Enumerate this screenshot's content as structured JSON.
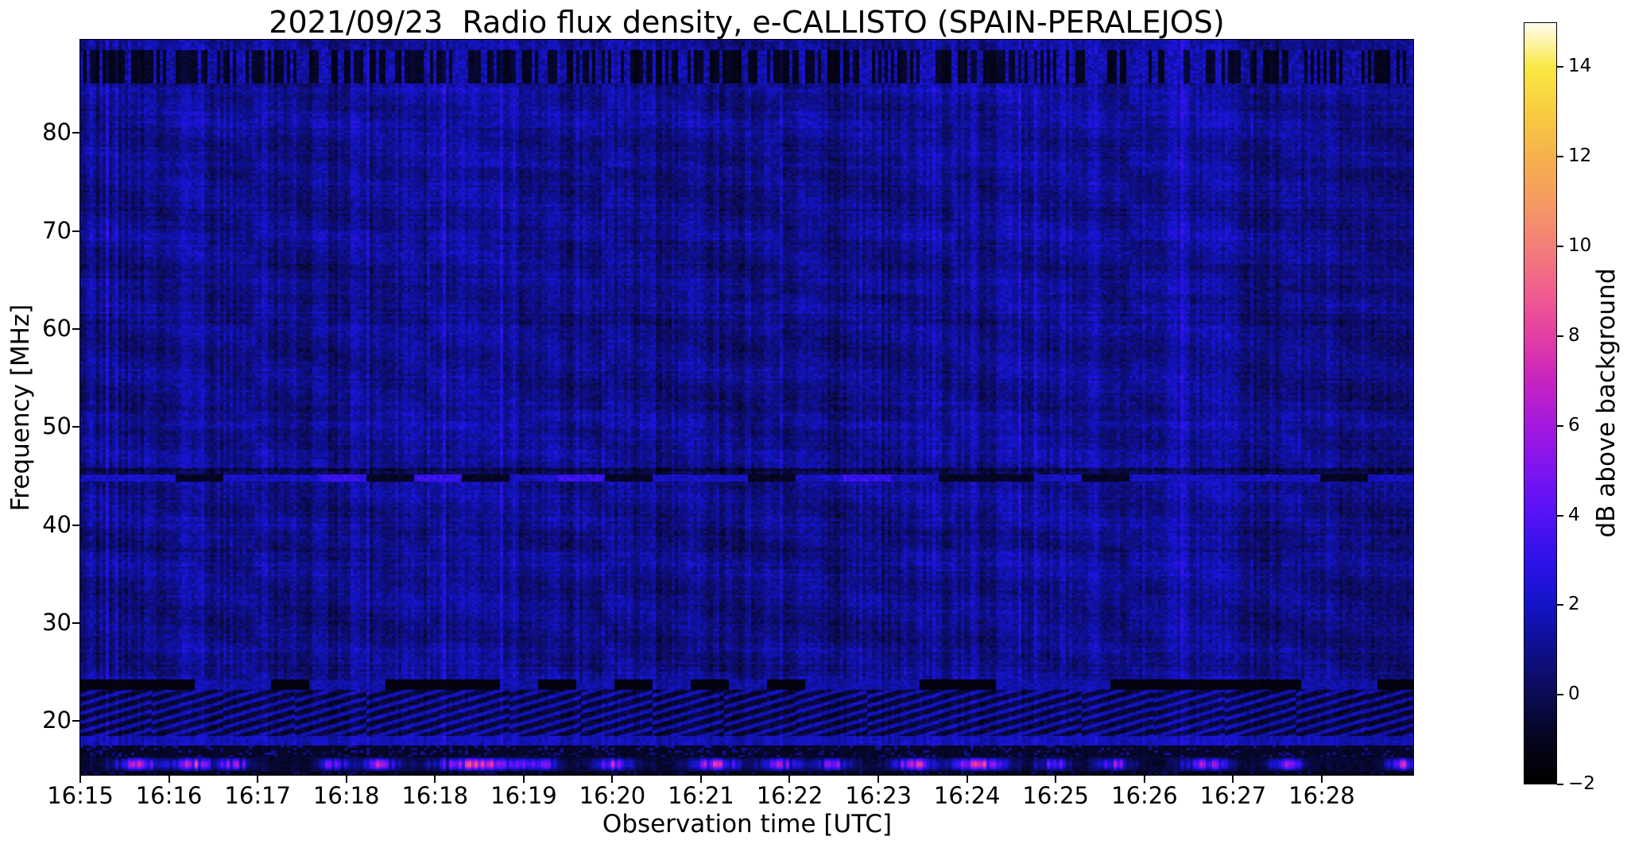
{
  "chart_data": {
    "type": "heatmap",
    "title": "2021/09/23  Radio flux density, e-CALLISTO (SPAIN-PERALEJOS)",
    "date": "2021/09/23",
    "station": "SPAIN-PERALEJOS",
    "xlabel": "Observation time [UTC]",
    "ylabel": "Frequency [MHz]",
    "x_tick_labels": [
      "16:15",
      "16:16",
      "16:17",
      "16:18",
      "16:18",
      "16:19",
      "16:20",
      "16:21",
      "16:22",
      "16:23",
      "16:24",
      "16:25",
      "16:26",
      "16:27",
      "16:28"
    ],
    "x_tick_fractions": [
      0.0,
      0.0665,
      0.1331,
      0.1996,
      0.2661,
      0.3327,
      0.3992,
      0.4657,
      0.5322,
      0.5988,
      0.6653,
      0.7318,
      0.7984,
      0.8649,
      0.9314
    ],
    "x_range_utc": [
      "16:15",
      "16:29"
    ],
    "y_ticks": [
      80,
      70,
      60,
      50,
      40,
      30,
      20
    ],
    "y_range": [
      14.5,
      89.5
    ],
    "grid": false,
    "legend": "none",
    "colorbar": {
      "label": "dB above background",
      "range": [
        -2,
        15
      ],
      "tick_values": [
        14,
        12,
        10,
        8,
        6,
        4,
        2,
        0,
        -2
      ],
      "tick_labels": [
        "14",
        "12",
        "10",
        "8",
        "6",
        "4",
        "2",
        "0",
        "−2"
      ],
      "stops": [
        [
          -2.0,
          "#000000"
        ],
        [
          -1.0,
          "#05051e"
        ],
        [
          0.0,
          "#0b0b55"
        ],
        [
          1.0,
          "#0f0f8c"
        ],
        [
          2.0,
          "#1414c8"
        ],
        [
          3.0,
          "#2e12ea"
        ],
        [
          4.0,
          "#5412f5"
        ],
        [
          5.0,
          "#7d14f0"
        ],
        [
          6.0,
          "#a318dd"
        ],
        [
          7.0,
          "#c724c0"
        ],
        [
          8.0,
          "#e43ea3"
        ],
        [
          9.0,
          "#f05e8d"
        ],
        [
          10.0,
          "#f37e79"
        ],
        [
          11.0,
          "#f59a62"
        ],
        [
          12.0,
          "#f6b14d"
        ],
        [
          13.0,
          "#f8cc40"
        ],
        [
          14.0,
          "#fae843"
        ],
        [
          15.0,
          "#fffdf0"
        ]
      ]
    },
    "features": {
      "background_level_db": 1.05,
      "bands": [
        {
          "name": "high-band-vertical-stripes",
          "y_frac": [
            0.013,
            0.059
          ],
          "type": "stripes"
        },
        {
          "name": "46mhz-dark-line",
          "y_frac": [
            0.582,
            0.591
          ],
          "type": "dark",
          "delta": -1.1
        },
        {
          "name": "46mhz-bright-dashed-line",
          "y_frac": [
            0.591,
            0.601
          ],
          "type": "bright_dashes"
        },
        {
          "name": "25mhz-dashed-line",
          "y_frac": [
            0.87,
            0.884
          ],
          "type": "dark_dashes"
        },
        {
          "name": "ionospheric-chevron-band",
          "y_frac": [
            0.884,
            0.946
          ],
          "type": "chevron"
        },
        {
          "name": "20mhz-bright-row",
          "y_frac": [
            0.946,
            0.96
          ],
          "type": "bright_row"
        },
        {
          "name": "dark-speckle-band",
          "y_frac": [
            0.96,
            0.975
          ],
          "type": "speckle_dark"
        },
        {
          "name": "rfi-blob-row",
          "y_frac": [
            0.975,
            0.995
          ],
          "type": "blob_row"
        },
        {
          "name": "bottom-edge-dark",
          "y_frac": [
            0.995,
            1.001
          ],
          "type": "bottom_dark"
        }
      ],
      "rfi_blobs": [
        {
          "x_frac": 0.045,
          "width_frac": 0.018,
          "peak_db": 6.5
        },
        {
          "x_frac": 0.085,
          "width_frac": 0.015,
          "peak_db": 7.2
        },
        {
          "x_frac": 0.115,
          "width_frac": 0.012,
          "peak_db": 5.8
        },
        {
          "x_frac": 0.19,
          "width_frac": 0.012,
          "peak_db": 5.0
        },
        {
          "x_frac": 0.225,
          "width_frac": 0.014,
          "peak_db": 6.0
        },
        {
          "x_frac": 0.3,
          "width_frac": 0.034,
          "peak_db": 7.5
        },
        {
          "x_frac": 0.345,
          "width_frac": 0.012,
          "peak_db": 5.5
        },
        {
          "x_frac": 0.4,
          "width_frac": 0.016,
          "peak_db": 6.2
        },
        {
          "x_frac": 0.475,
          "width_frac": 0.02,
          "peak_db": 6.8
        },
        {
          "x_frac": 0.525,
          "width_frac": 0.016,
          "peak_db": 6.0
        },
        {
          "x_frac": 0.565,
          "width_frac": 0.014,
          "peak_db": 5.2
        },
        {
          "x_frac": 0.625,
          "width_frac": 0.018,
          "peak_db": 6.5
        },
        {
          "x_frac": 0.675,
          "width_frac": 0.02,
          "peak_db": 7.3
        },
        {
          "x_frac": 0.73,
          "width_frac": 0.012,
          "peak_db": 5.0
        },
        {
          "x_frac": 0.775,
          "width_frac": 0.014,
          "peak_db": 5.5
        },
        {
          "x_frac": 0.845,
          "width_frac": 0.016,
          "peak_db": 6.0
        },
        {
          "x_frac": 0.905,
          "width_frac": 0.014,
          "peak_db": 5.2
        },
        {
          "x_frac": 0.992,
          "width_frac": 0.012,
          "peak_db": 6.3
        }
      ]
    }
  }
}
